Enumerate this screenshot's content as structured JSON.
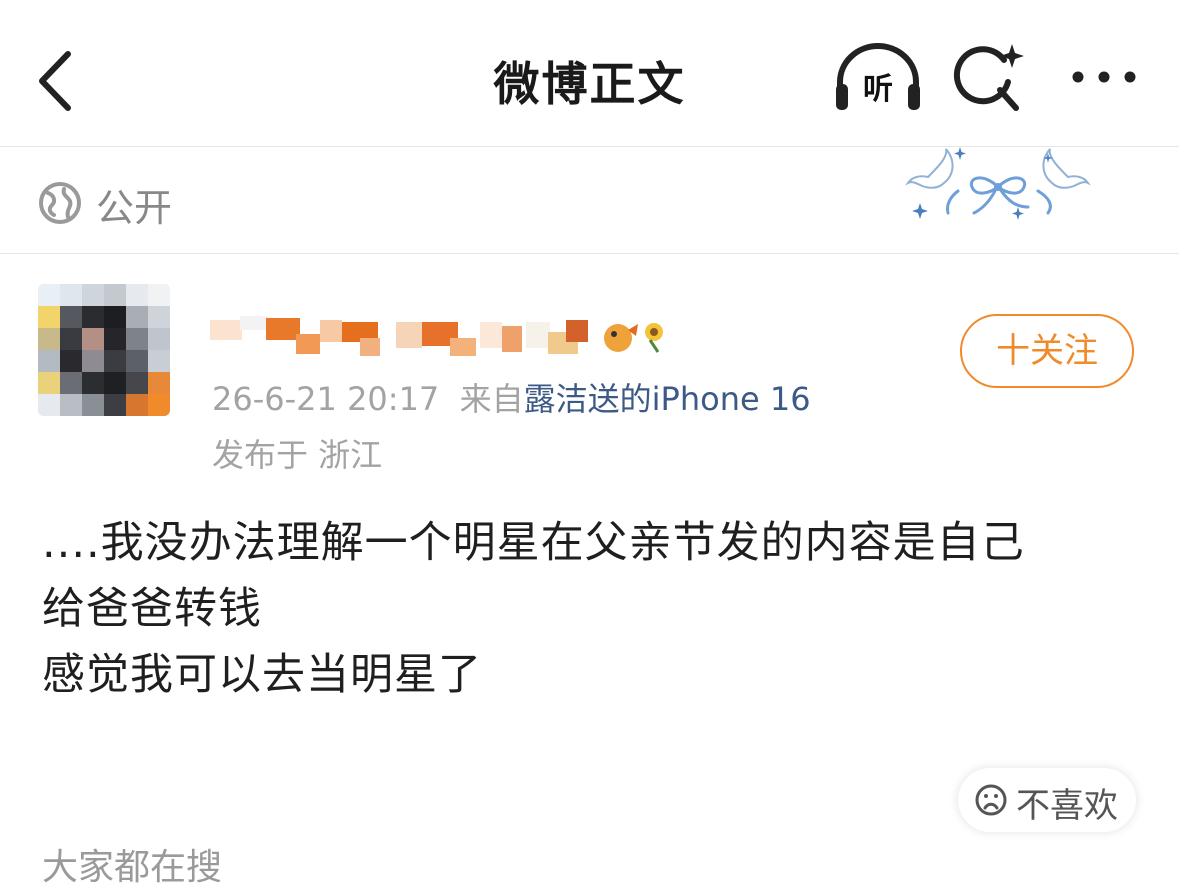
{
  "header": {
    "title": "微博正文",
    "listen_label": "听"
  },
  "visibility": {
    "label": "公开"
  },
  "post": {
    "timestamp": "26-6-21 20:17",
    "source_prefix": "来自",
    "source": "露洁送的iPhone 16",
    "location": "发布于 浙江",
    "follow_label": "十关注",
    "lines": [
      "....我没办法理解一个明星在父亲节发的内容是自己",
      "给爸爸转钱",
      "感觉我可以去当明星了"
    ]
  },
  "actions": {
    "dislike_label": "不喜欢"
  },
  "section": {
    "trending_title": "大家都在搜"
  },
  "colors": {
    "accent": "#f08a2a",
    "link": "#3d5a87",
    "muted": "#a3a3a3"
  },
  "icons": [
    "back-arrow-icon",
    "headphones-icon",
    "search-sparkle-icon",
    "more-dots-icon",
    "globe-icon",
    "dislike-face-icon"
  ]
}
